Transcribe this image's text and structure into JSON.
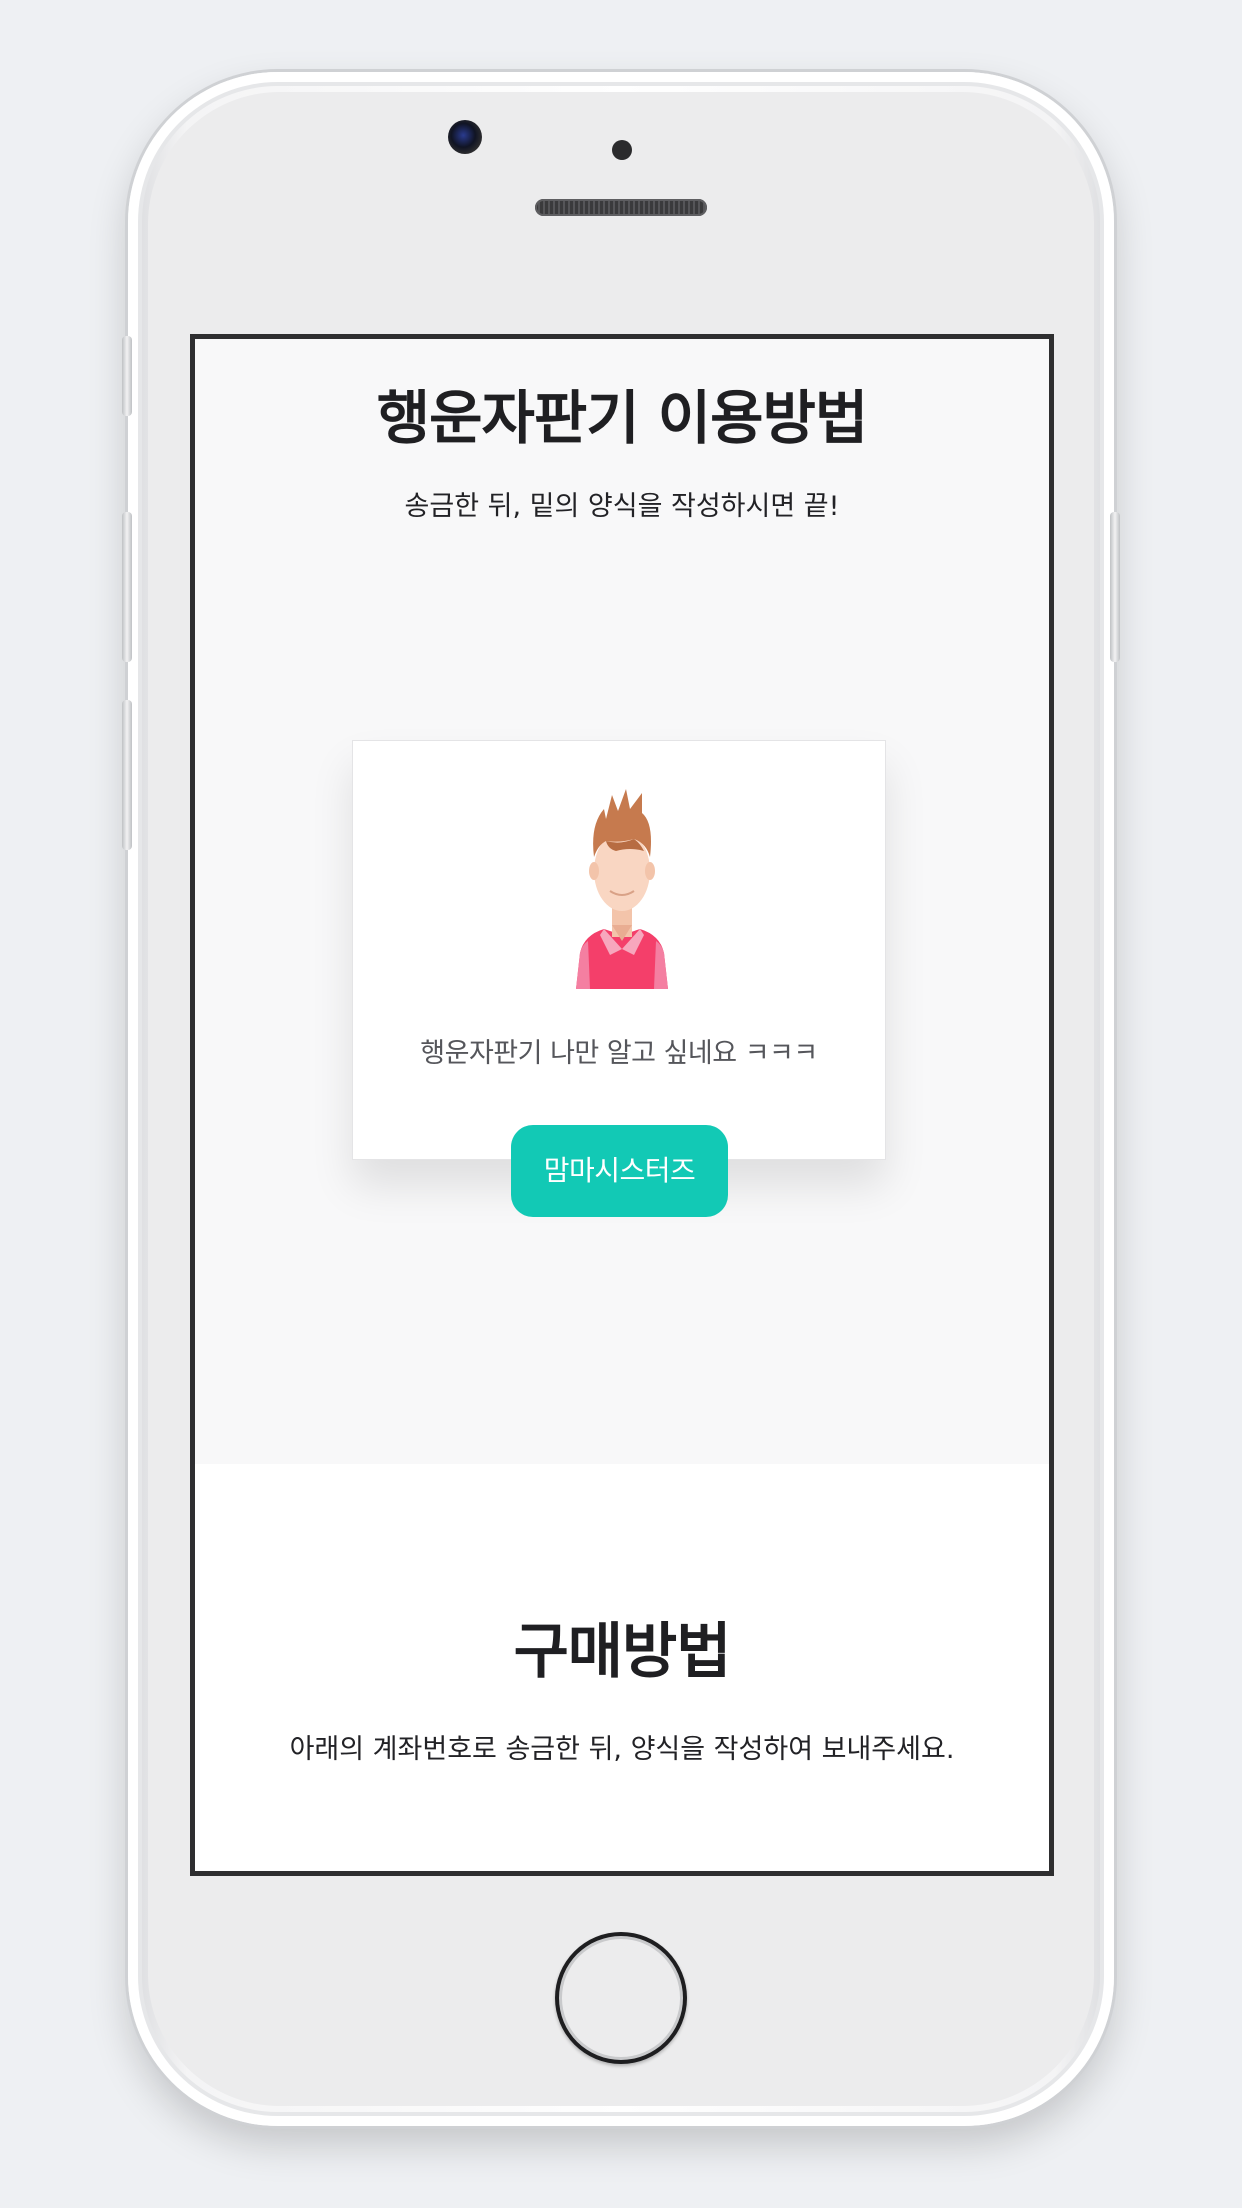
{
  "section1": {
    "title": "행운자판기 이용방법",
    "subtitle": "송금한 뒤, 밑의 양식을 작성하시면 끝!"
  },
  "card": {
    "text": "행운자판기 나만 알고 싶네요 ㅋㅋㅋ",
    "avatar_icon": "person-avatar-icon"
  },
  "cta_button": {
    "label": "맘마시스터즈",
    "color": "#12c9b5"
  },
  "section2": {
    "title": "구매방법",
    "subtitle": "아래의 계좌번호로 송금한 뒤, 양식을 작성하여 보내주세요."
  },
  "colors": {
    "accent": "#12c9b5",
    "section_bg": "#f8f8f9",
    "text": "#1f1f22"
  }
}
